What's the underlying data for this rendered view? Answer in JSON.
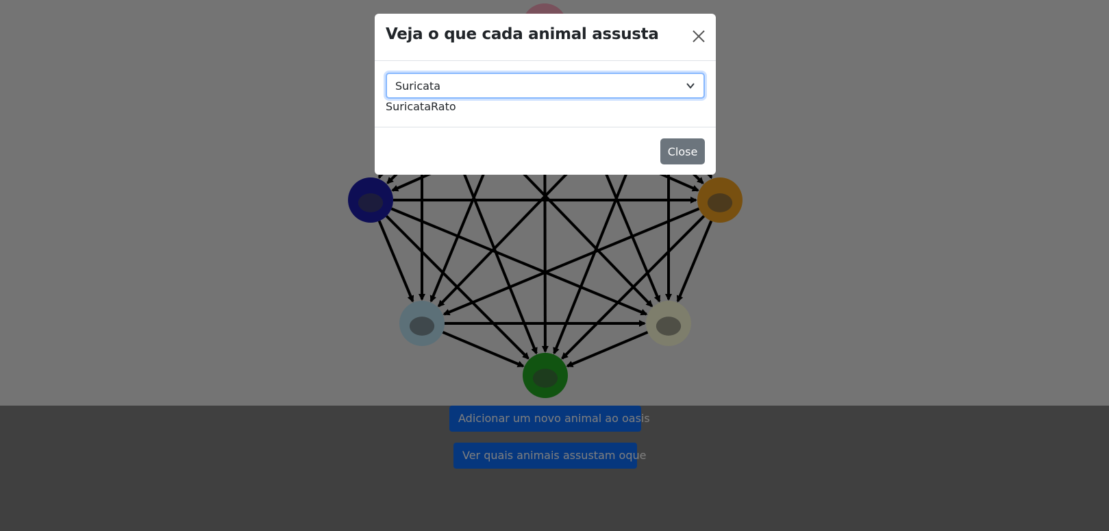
{
  "page": {
    "add_button_label": "Adicionar um novo animal ao oasis",
    "view_button_label": "Ver quais animais assustam oque"
  },
  "graph": {
    "nodes": [
      {
        "id": "rato",
        "icon": "rat-icon",
        "color": "#f2a3b8"
      },
      {
        "id": "rinoceronte",
        "icon": "rhino-icon",
        "color": "#1c1caa"
      },
      {
        "id": "zebra",
        "icon": "zebra-icon",
        "color": "#f0a020"
      },
      {
        "id": "leopardo",
        "icon": "leopard-icon",
        "color": "#b8e0f0"
      },
      {
        "id": "girafa",
        "icon": "giraffe-icon",
        "color": "#fcfcd8"
      },
      {
        "id": "avestruz",
        "icon": "ostrich-icon",
        "color": "#22a822"
      }
    ]
  },
  "modal": {
    "title": "Veja o que cada animal assusta",
    "select_value": "Suricata",
    "result_text": "SuricataRato",
    "close_button_label": "Close",
    "select_focus_color": "#86b7fe",
    "close_button_color": "#6c757d"
  },
  "colors": {
    "primary": "#0d6efd",
    "backdrop": "rgba(0,0,0,0.5)"
  }
}
